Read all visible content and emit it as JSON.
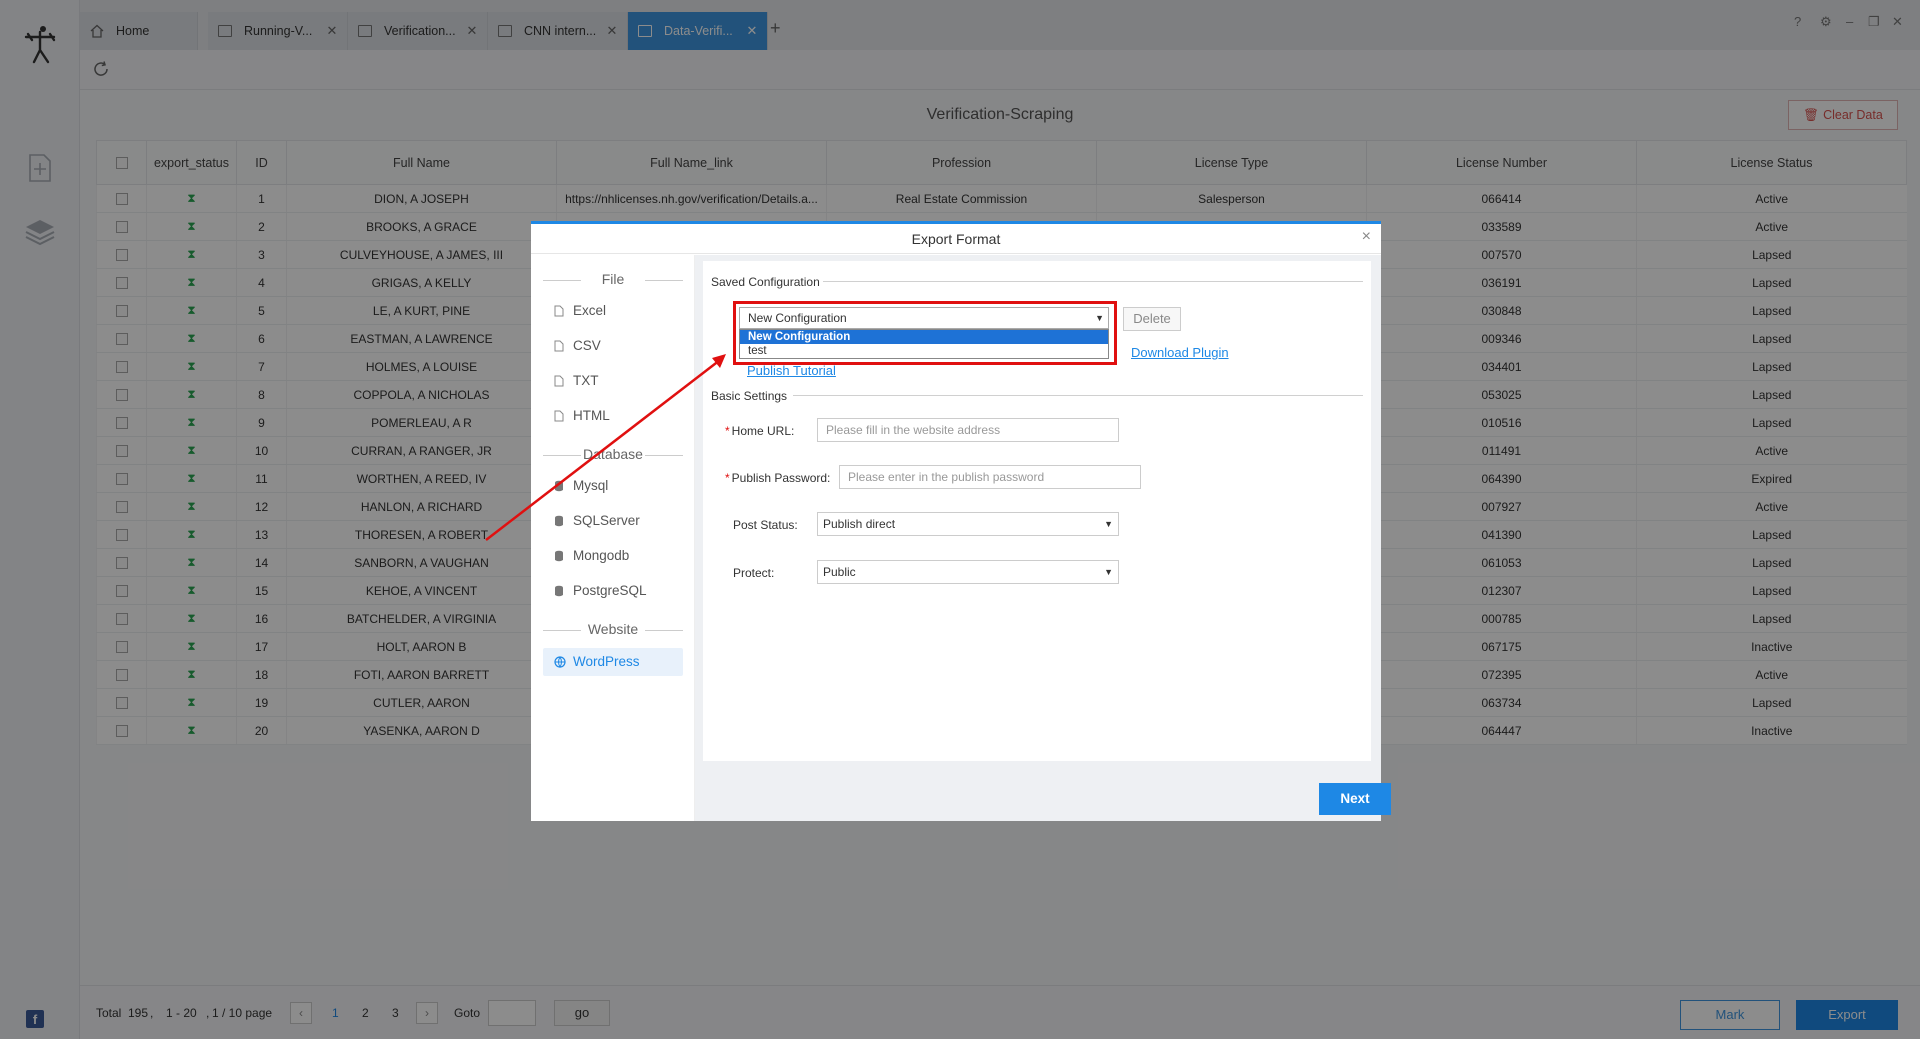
{
  "tabs": [
    {
      "label": "Home"
    },
    {
      "label": "Running-V..."
    },
    {
      "label": "Verification..."
    },
    {
      "label": "CNN intern..."
    },
    {
      "label": "Data-Verifi..."
    }
  ],
  "tab_add": "+",
  "window_controls": {
    "help": "?",
    "settings": "⚙",
    "minimize": "–",
    "restore": "❐",
    "close": "✕"
  },
  "page": {
    "title": "Verification-Scraping",
    "clear_data": "Clear Data"
  },
  "table": {
    "columns": [
      "export_status",
      "ID",
      "Full Name",
      "Full Name_link",
      "Profession",
      "License Type",
      "License Number",
      "License Status"
    ],
    "rows": [
      {
        "id": "1",
        "name": "DION, A JOSEPH",
        "link": "https://nhlicenses.nh.gov/verification/Details.a...",
        "profession": "Real Estate Commission",
        "type": "Salesperson",
        "number": "066414",
        "status": "Active"
      },
      {
        "id": "2",
        "name": "BROOKS, A GRACE",
        "link": "",
        "profession": "",
        "type": "",
        "number": "033589",
        "status": "Active"
      },
      {
        "id": "3",
        "name": "CULVEYHOUSE, A JAMES, III",
        "link": "",
        "profession": "",
        "type": "",
        "number": "007570",
        "status": "Lapsed"
      },
      {
        "id": "4",
        "name": "GRIGAS, A KELLY",
        "link": "",
        "profession": "",
        "type": "",
        "number": "036191",
        "status": "Lapsed"
      },
      {
        "id": "5",
        "name": "LE, A KURT, PINE",
        "link": "",
        "profession": "",
        "type": "",
        "number": "030848",
        "status": "Lapsed"
      },
      {
        "id": "6",
        "name": "EASTMAN, A LAWRENCE",
        "link": "",
        "profession": "",
        "type": "",
        "number": "009346",
        "status": "Lapsed"
      },
      {
        "id": "7",
        "name": "HOLMES, A LOUISE",
        "link": "",
        "profession": "",
        "type": "",
        "number": "034401",
        "status": "Lapsed"
      },
      {
        "id": "8",
        "name": "COPPOLA, A NICHOLAS",
        "link": "",
        "profession": "",
        "type": "",
        "number": "053025",
        "status": "Lapsed"
      },
      {
        "id": "9",
        "name": "POMERLEAU, A R",
        "link": "",
        "profession": "",
        "type": "",
        "number": "010516",
        "status": "Lapsed"
      },
      {
        "id": "10",
        "name": "CURRAN, A RANGER, JR",
        "link": "",
        "profession": "",
        "type": "",
        "number": "011491",
        "status": "Active"
      },
      {
        "id": "11",
        "name": "WORTHEN, A REED, IV",
        "link": "",
        "profession": "",
        "type": "",
        "number": "064390",
        "status": "Expired"
      },
      {
        "id": "12",
        "name": "HANLON, A RICHARD",
        "link": "",
        "profession": "",
        "type": "",
        "number": "007927",
        "status": "Active"
      },
      {
        "id": "13",
        "name": "THORESEN, A ROBERT",
        "link": "",
        "profession": "",
        "type": "",
        "number": "041390",
        "status": "Lapsed"
      },
      {
        "id": "14",
        "name": "SANBORN, A VAUGHAN",
        "link": "",
        "profession": "",
        "type": "",
        "number": "061053",
        "status": "Lapsed"
      },
      {
        "id": "15",
        "name": "KEHOE, A VINCENT",
        "link": "",
        "profession": "",
        "type": "",
        "number": "012307",
        "status": "Lapsed"
      },
      {
        "id": "16",
        "name": "BATCHELDER, A VIRGINIA",
        "link": "",
        "profession": "",
        "type": "",
        "number": "000785",
        "status": "Lapsed"
      },
      {
        "id": "17",
        "name": "HOLT, AARON B",
        "link": "",
        "profession": "",
        "type": "",
        "number": "067175",
        "status": "Inactive"
      },
      {
        "id": "18",
        "name": "FOTI, AARON BARRETT",
        "link": "",
        "profession": "",
        "type": "",
        "number": "072395",
        "status": "Active"
      },
      {
        "id": "19",
        "name": "CUTLER, AARON",
        "link": "",
        "profession": "",
        "type": "",
        "number": "063734",
        "status": "Lapsed"
      },
      {
        "id": "20",
        "name": "YASENKA, AARON D",
        "link": "",
        "profession": "",
        "type": "",
        "number": "064447",
        "status": "Inactive"
      }
    ]
  },
  "pager": {
    "total_label": "Total",
    "total": "195",
    "range": "1 - 20",
    "page_info": "1 / 10 page",
    "pages": [
      "1",
      "2",
      "3"
    ],
    "goto_label": "Goto",
    "go_label": "go",
    "mark": "Mark",
    "export": "Export"
  },
  "modal": {
    "title": "Export Format",
    "close": "×",
    "sections": {
      "file": "File",
      "database": "Database",
      "website": "Website"
    },
    "file_items": [
      "Excel",
      "CSV",
      "TXT",
      "HTML"
    ],
    "db_items": [
      "Mysql",
      "SQLServer",
      "Mongodb",
      "PostgreSQL"
    ],
    "web_items": [
      "WordPress"
    ],
    "saved_config_label": "Saved Configuration",
    "config_selected": "New Configuration",
    "config_options": [
      "New Configuration",
      "test"
    ],
    "delete_label": "Delete",
    "download_plugin": "Download Plugin",
    "publish_tutorial": "Publish Tutorial",
    "basic_settings_label": "Basic Settings",
    "home_url_label": "Home URL:",
    "home_url_placeholder": "Please fill in the website address",
    "publish_password_label": "Publish Password:",
    "publish_password_placeholder": "Please enter in the publish password",
    "post_status_label": "Post Status:",
    "post_status_value": "Publish direct",
    "protect_label": "Protect:",
    "protect_value": "Public",
    "next_label": "Next"
  },
  "colors": {
    "accent": "#1e88e5",
    "annotation": "#e01010",
    "status_icon": "#2aa652"
  }
}
